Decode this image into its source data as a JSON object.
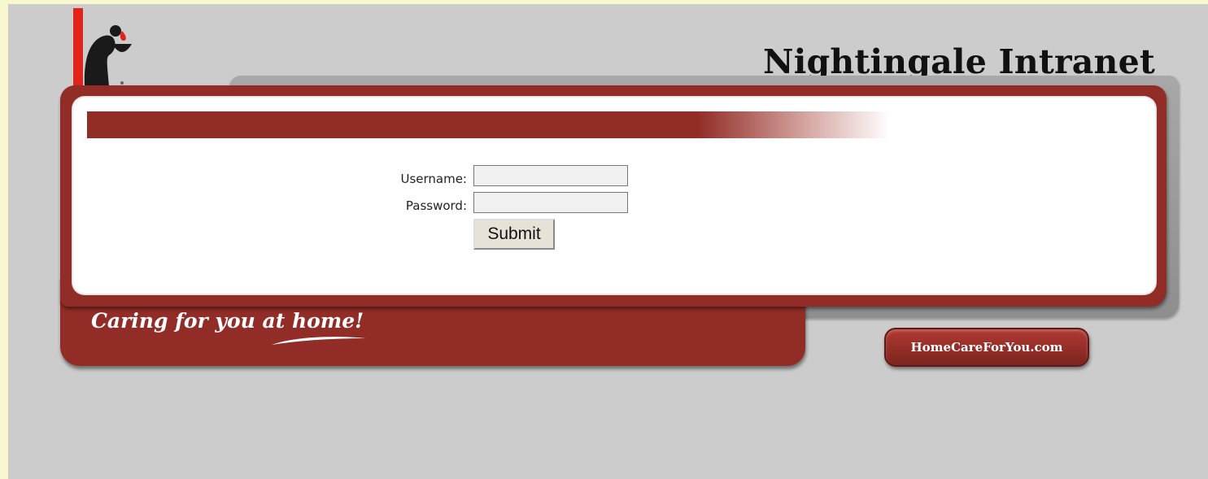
{
  "header": {
    "title": "Nightingale Intranet"
  },
  "login": {
    "username_label": "Username:",
    "username_value": "",
    "password_label": "Password:",
    "password_value": "",
    "submit_label": "Submit"
  },
  "footer": {
    "slogan": "Caring for you at home!",
    "link_label": "HomeCareForYou.com"
  },
  "colors": {
    "brand_maroon": "#922c26",
    "page_background": "#cccccc",
    "outer_background": "#f8f8d0",
    "back_tab_grey": "#9a9a9a"
  },
  "icons": {
    "logo": "nightingale-logo"
  }
}
